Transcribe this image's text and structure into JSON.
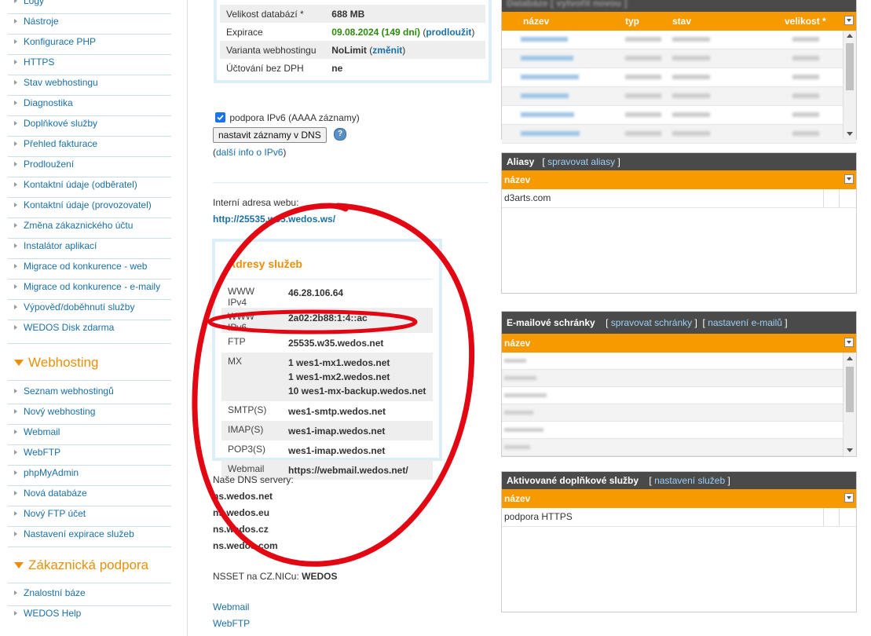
{
  "sidebar": {
    "items_top": [
      "Logy",
      "Nástroje",
      "Konfigurace PHP",
      "HTTPS",
      "Stav webhostingu",
      "Diagnostika",
      "Doplňkové služby",
      "Přehled fakturace",
      "Prodloužení",
      "Kontaktní údaje (odběratel)",
      "Kontaktní údaje (provozovatel)",
      "Změna zákaznického účtu",
      "Instalátor aplikací",
      "Migrace od konkurence - web",
      "Migrace od konkurence - e-maily",
      "Výpověď/doběhnutí služby",
      "WEDOS Disk zdarma"
    ],
    "section_webhosting": "Webhosting",
    "items_webhosting": [
      "Seznam webhostingů",
      "Nový webhosting",
      "Webmail",
      "WebFTP",
      "phpMyAdmin",
      "Nová databáze",
      "Nový FTP účet",
      "Nastavení expirace služeb"
    ],
    "section_support": "Zákaznická podpora",
    "items_support": [
      "Znalostní báze",
      "WEDOS Help"
    ]
  },
  "info": {
    "db_size_label": "Velikost databází *",
    "db_size_value": "688 MB",
    "expiry_label": "Expirace",
    "expiry_value": "09.08.2024 (149 dní)",
    "expiry_link": "prodloužit",
    "variant_label": "Varianta webhostingu",
    "variant_value": "NoLimit",
    "variant_link": "změnit",
    "vat_label": "Účtování bez DPH",
    "vat_value": "ne"
  },
  "ipv6": {
    "checkbox_label": "podpora IPv6 (AAAA záznamy)",
    "checked": true,
    "button_label": "nastavit záznamy v DNS",
    "help_glyph": "?",
    "more_info_link": "další info o IPv6"
  },
  "internal": {
    "label": "Interní adresa webu:",
    "url": "http://25535.w35.wedos.ws/"
  },
  "services": {
    "title": "Adresy služeb",
    "rows": [
      {
        "label": "WWW IPv4",
        "values": [
          "46.28.106.64"
        ]
      },
      {
        "label": "WWW IPv6",
        "values": [
          "2a02:2b88:1:4::ac"
        ]
      },
      {
        "label": "FTP",
        "values": [
          "25535.w35.wedos.net"
        ]
      },
      {
        "label": "MX",
        "values": [
          "1 wes1-mx1.wedos.net",
          "1 wes1-mx2.wedos.net",
          "10 wes1-mx-backup.wedos.net"
        ]
      },
      {
        "label": "SMTP(S)",
        "values": [
          "wes1-smtp.wedos.net"
        ]
      },
      {
        "label": "IMAP(S)",
        "values": [
          "wes1-imap.wedos.net"
        ]
      },
      {
        "label": "POP3(S)",
        "values": [
          "wes1-imap.wedos.net"
        ]
      },
      {
        "label": "Webmail",
        "values": [
          "https://webmail.wedos.net/"
        ]
      }
    ]
  },
  "dns": {
    "label": "Naše DNS servery:",
    "servers": [
      "ns.wedos.net",
      "ns.wedos.eu",
      "ns.wedos.cz",
      "ns.wedos.com"
    ],
    "nsset_label": "NSSET na CZ.NICu:",
    "nsset_value": "WEDOS"
  },
  "bottom_links": [
    "Webmail",
    "WebFTP"
  ],
  "databases": {
    "col_name": "název",
    "col_type": "typ",
    "col_state": "stav",
    "col_size": "velikost *"
  },
  "aliases": {
    "title": "Aliasy",
    "manage_link": "spravovat aliasy",
    "col_name": "název",
    "rows": [
      "d3arts.com"
    ]
  },
  "mailboxes": {
    "title": "E-mailové schránky",
    "manage_link": "spravovat schránky",
    "settings_link": "nastavení e-mailů",
    "col_name": "název"
  },
  "addons": {
    "title": "Aktivované doplňkové služby",
    "settings_link": "nastavení služeb",
    "col_name": "název",
    "rows": [
      "podpora HTTPS"
    ]
  },
  "colors": {
    "accent_orange": "#f79a00",
    "heading_orange": "#e8900a",
    "panel_title": "#4a4a4a",
    "link_blue": "#1a6fa8",
    "annotation_red": "#e30613"
  }
}
